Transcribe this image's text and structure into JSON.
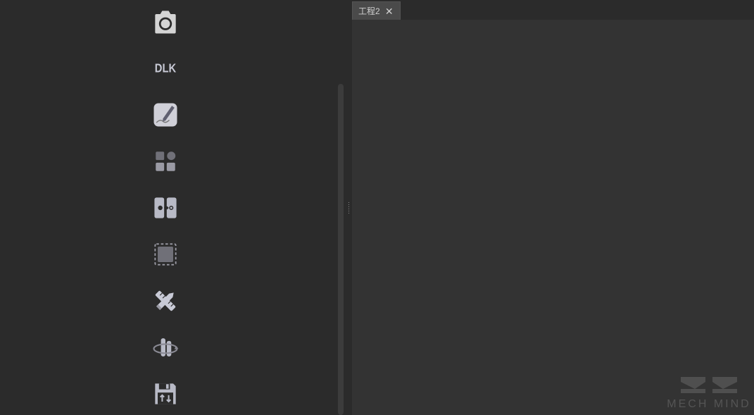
{
  "tab": {
    "label": "工程2",
    "close_symbol": "✕"
  },
  "tools": [
    {
      "name": "camera-icon"
    },
    {
      "name": "dlk-icon"
    },
    {
      "name": "draw-icon"
    },
    {
      "name": "shapes-icon"
    },
    {
      "name": "split-icon"
    },
    {
      "name": "frame-icon"
    },
    {
      "name": "measure-icon"
    },
    {
      "name": "rotate3d-icon"
    },
    {
      "name": "save-transfer-icon"
    }
  ],
  "watermark": {
    "brand": "MECH MIND"
  }
}
